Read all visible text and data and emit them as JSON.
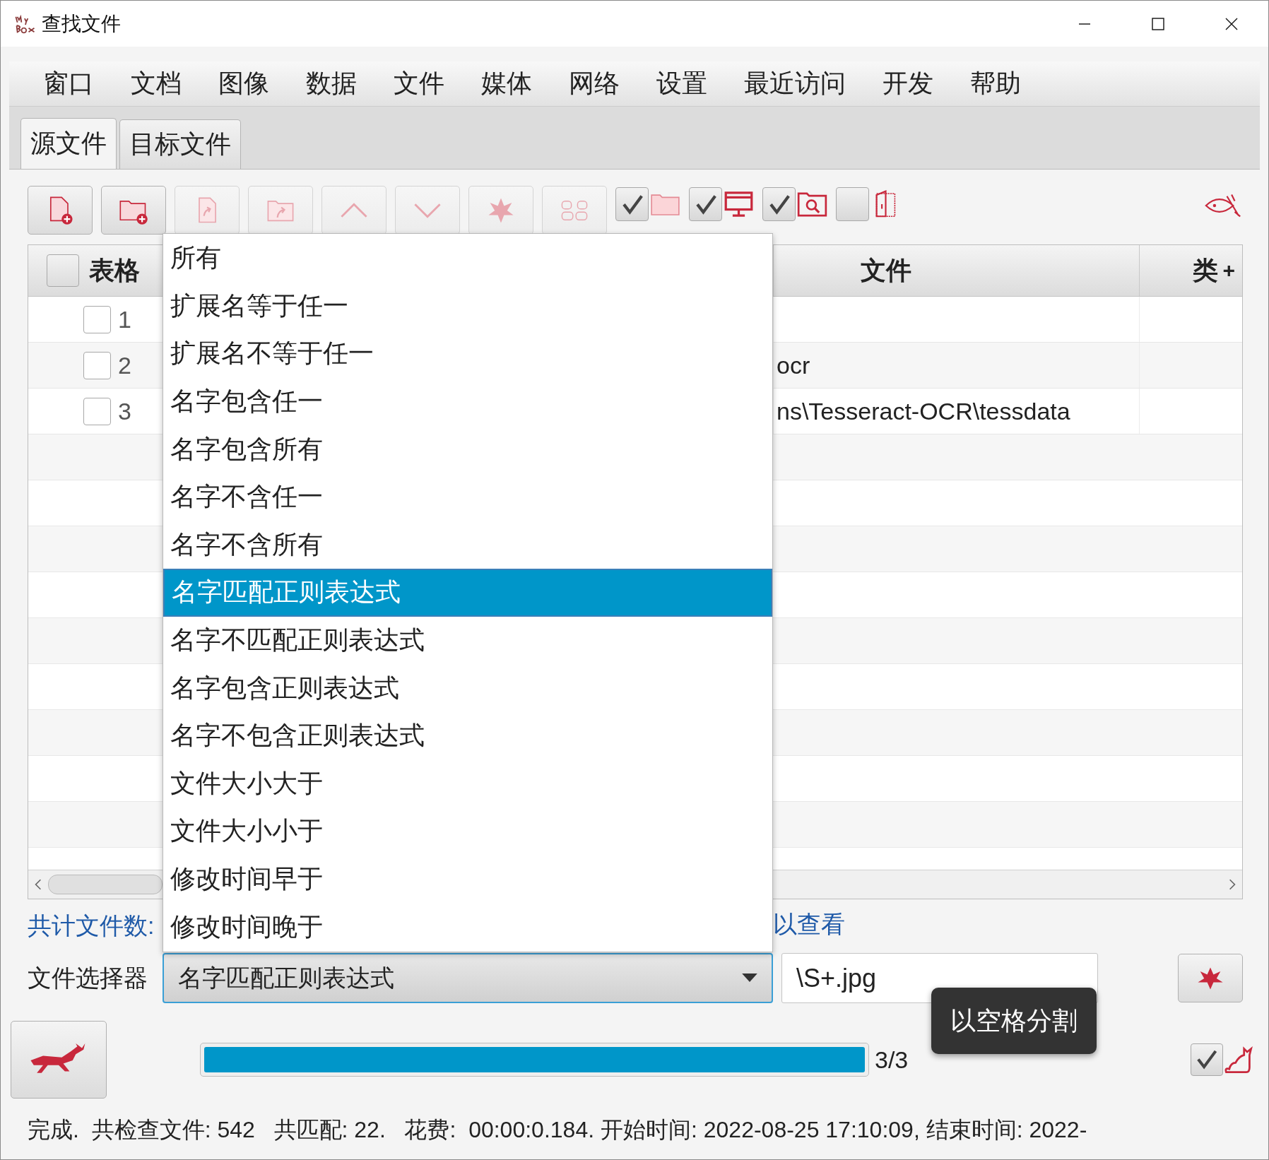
{
  "window": {
    "title": "查找文件"
  },
  "menu": [
    "窗口",
    "文档",
    "图像",
    "数据",
    "文件",
    "媒体",
    "网络",
    "设置",
    "最近访问",
    "开发",
    "帮助"
  ],
  "tabs": [
    {
      "label": "源文件",
      "selected": true
    },
    {
      "label": "目标文件",
      "selected": false
    }
  ],
  "toolbar": {
    "buttons": [
      {
        "kind": "add-file",
        "disabled": false
      },
      {
        "kind": "add-folder",
        "disabled": false
      },
      {
        "kind": "insert-file",
        "disabled": true
      },
      {
        "kind": "insert-folder",
        "disabled": true
      },
      {
        "kind": "up",
        "disabled": true
      },
      {
        "kind": "down",
        "disabled": true
      },
      {
        "kind": "flower",
        "disabled": true
      },
      {
        "kind": "pattern",
        "disabled": true
      }
    ],
    "toggles": [
      {
        "kind": "folder",
        "checked": true
      },
      {
        "kind": "screen",
        "checked": true
      },
      {
        "kind": "folder-search",
        "checked": true
      },
      {
        "kind": "door",
        "checked": false
      }
    ]
  },
  "table": {
    "columns": [
      "表格",
      "文件",
      "类"
    ],
    "column_menu": "+",
    "header_checked": false,
    "rows": [
      {
        "number": "1",
        "checked": false
      },
      {
        "number": "2",
        "checked": false,
        "file": "ocr"
      },
      {
        "number": "3",
        "checked": false,
        "file": "ns\\Tesseract-OCR\\tessdata"
      }
    ]
  },
  "info": {
    "count_label": "共计文件数:",
    "hint": "以查看"
  },
  "selector": {
    "label": "文件选择器",
    "value": "名字匹配正则表达式",
    "input": "\\S+.jpg",
    "options": [
      {
        "label": "所有",
        "selected": false
      },
      {
        "label": "扩展名等于任一",
        "selected": false
      },
      {
        "label": "扩展名不等于任一",
        "selected": false
      },
      {
        "label": "名字包含任一",
        "selected": false
      },
      {
        "label": "名字包含所有",
        "selected": false
      },
      {
        "label": "名字不含任一",
        "selected": false
      },
      {
        "label": "名字不含所有",
        "selected": false
      },
      {
        "label": "名字匹配正则表达式",
        "selected": true
      },
      {
        "label": "名字不匹配正则表达式",
        "selected": false
      },
      {
        "label": "名字包含正则表达式",
        "selected": false
      },
      {
        "label": "名字不包含正则表达式",
        "selected": false
      },
      {
        "label": "文件大小大于",
        "selected": false
      },
      {
        "label": "文件大小小于",
        "selected": false
      },
      {
        "label": "修改时间早于",
        "selected": false
      },
      {
        "label": "修改时间晚于",
        "selected": false
      }
    ]
  },
  "tooltip": "以空格分割",
  "progress": {
    "level": 1,
    "text": "3/3"
  },
  "option_checkbox": {
    "checked": true
  },
  "status": "完成.  共检查文件: 542   共匹配: 22.   花费:  00:00:0.184. 开始时间: 2022-08-25 17:10:09, 结束时间: 2022-"
}
